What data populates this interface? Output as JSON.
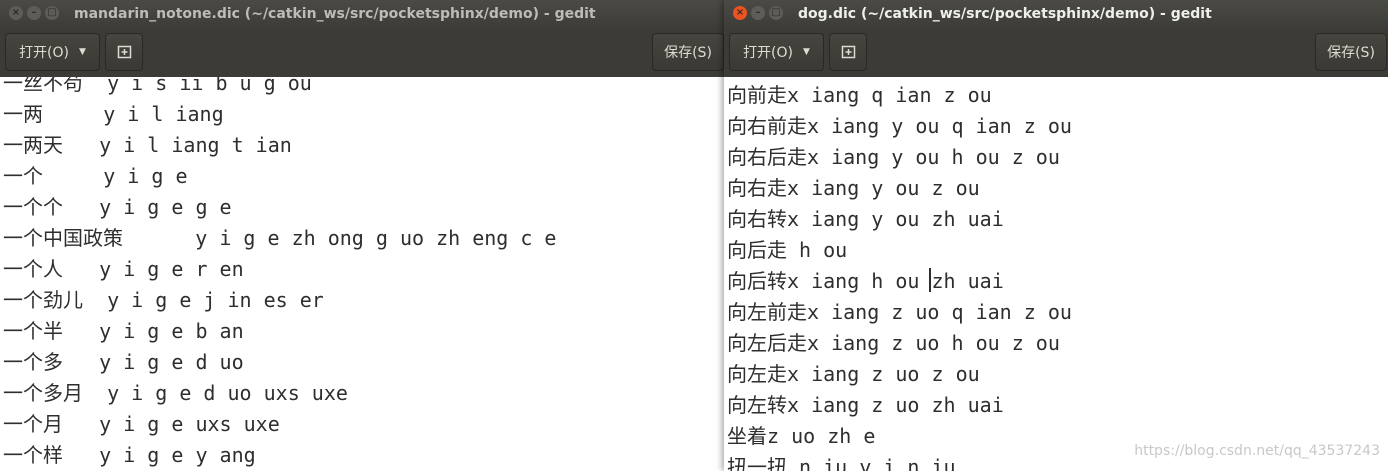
{
  "left_window": {
    "title": "mandarin_notone.dic (~/catkin_ws/src/pocketsphinx/demo) - gedit",
    "window_buttons": {
      "close": "×",
      "minimize": "–",
      "maximize": "□"
    },
    "toolbar": {
      "open_label": "打开(O)",
      "save_label": "保存(S)"
    },
    "lines": [
      "一丝不苟  y i s ii b u g ou",
      "一两     y i l iang",
      "一两天   y i l iang t ian",
      "一个     y i g e",
      "一个个   y i g e g e",
      "一个中国政策      y i g e zh ong g uo zh eng c e",
      "一个人   y i g e r en",
      "一个劲儿  y i g e j in es er",
      "一个半   y i g e b an",
      "一个多   y i g e d uo",
      "一个多月  y i g e d uo uxs uxe",
      "一个月   y i g e uxs uxe",
      "一个样   y i g e y ang"
    ]
  },
  "right_window": {
    "title": "dog.dic (~/catkin_ws/src/pocketsphinx/demo) - gedit",
    "window_buttons": {
      "close": "×",
      "minimize": "–",
      "maximize": "□"
    },
    "toolbar": {
      "open_label": "打开(O)",
      "save_label": "保存(S)"
    },
    "lines": [
      "向前走x iang q ian z ou",
      "向右前走x iang y ou q ian z ou",
      "向右后走x iang y ou h ou z ou",
      "向右走x iang y ou z ou",
      "向右转x iang y ou zh uai",
      "向后走 h ou",
      "向后转x iang h ou zh uai",
      "向左前走x iang z uo q ian z ou",
      "向左后走x iang z uo h ou z ou",
      "向左走x iang z uo z ou",
      "向左转x iang z uo zh uai",
      "坐着z uo zh e",
      "扭一扭 n iu y i n iu"
    ],
    "watermark": "https://blog.csdn.net/qq_43537243"
  },
  "colors": {
    "titlebar": "#3d3c38",
    "toolbar": "#3c3b37",
    "close_button": "#e95420",
    "editor_background": "#ffffff",
    "editor_text": "#2e2e2e"
  }
}
